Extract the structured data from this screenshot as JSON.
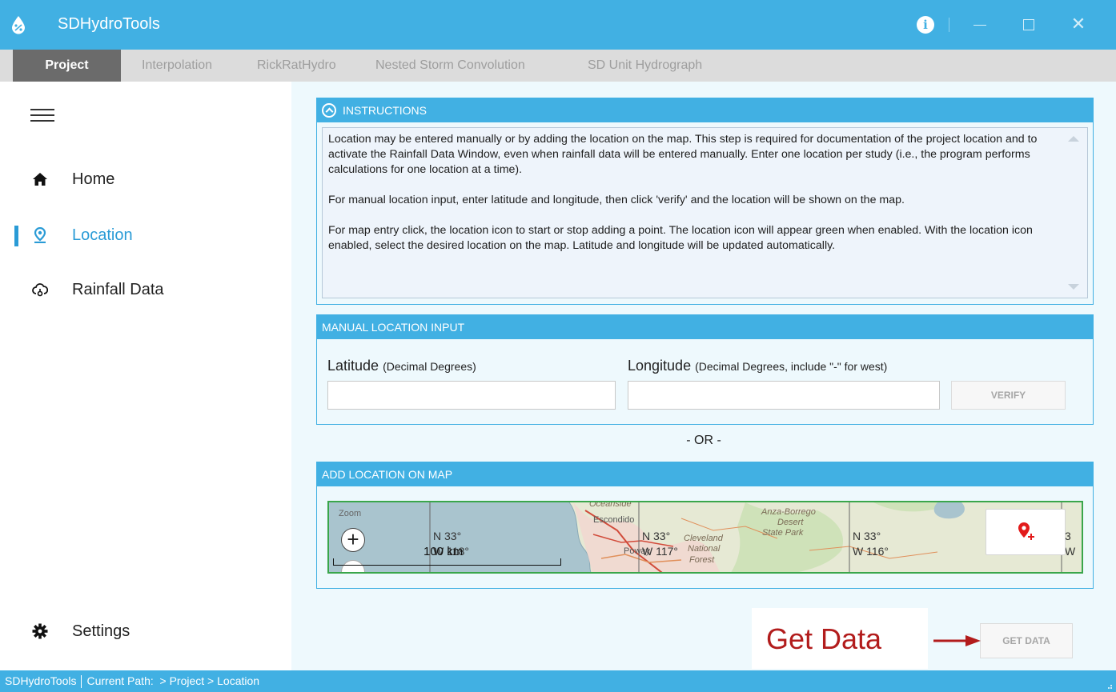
{
  "app": {
    "title": "SDHydroTools",
    "icon": "droplet-icon",
    "accent_color": "#41b0e3"
  },
  "tabs": [
    {
      "label": "Project",
      "active": true
    },
    {
      "label": "Interpolation",
      "active": false
    },
    {
      "label": "RickRatHydro",
      "active": false
    },
    {
      "label": "Nested Storm Convolution",
      "active": false
    },
    {
      "label": "SD Unit Hydrograph",
      "active": false
    }
  ],
  "sidebar": {
    "items": [
      {
        "label": "Home",
        "icon": "home-icon",
        "active": false
      },
      {
        "label": "Location",
        "icon": "location-person-icon",
        "active": true
      },
      {
        "label": "Rainfall Data",
        "icon": "cloud-upload-icon",
        "active": false
      }
    ],
    "settings_label": "Settings",
    "settings_icon": "gear-icon"
  },
  "instructions": {
    "title": "INSTRUCTIONS",
    "paragraphs": [
      "Location may be entered manually or by adding the location on the map. This step is required for documentation of the project location and to activate the Rainfall Data Window, even when rainfall data will be entered manually. Enter one location per study (i.e., the program performs calculations for one location at a time).",
      "For manual location input, enter latitude and longitude, then click 'verify' and the location will be shown on the map.",
      "For map entry click, the location icon to start or stop adding a point. The location icon will appear green when enabled. With the location icon enabled, select the desired location on the map. Latitude and longitude will be updated automatically."
    ]
  },
  "manual": {
    "title": "MANUAL LOCATION INPUT",
    "latitude_label": "Latitude",
    "latitude_hint": "(Decimal Degrees)",
    "latitude_value": "",
    "longitude_label": "Longitude",
    "longitude_hint": "(Decimal Degrees, include \"-\" for west)",
    "longitude_value": "",
    "verify_label": "VERIFY"
  },
  "or_text": "- OR -",
  "map": {
    "title": "ADD LOCATION ON MAP",
    "zoom_label": "Zoom",
    "zoom_in": "+",
    "scale_label": "100 km",
    "grid_labels": [
      {
        "lat": "N 33°",
        "lon": "W 118°"
      },
      {
        "lat": "N 33°",
        "lon": "W 117°"
      },
      {
        "lat": "N 33°",
        "lon": "W 116°"
      },
      {
        "lat": "3",
        "lon": "W"
      }
    ],
    "places": [
      "Escondido",
      "Poway",
      "Cleveland",
      "National",
      "Forest",
      "Anza-Borrego",
      "Desert",
      "State Park",
      "Oceanside"
    ],
    "add_point_icon": "map-pin-add-icon"
  },
  "get_data_label": "GET DATA",
  "annotation": {
    "text": "Get Data"
  },
  "status": {
    "app_name": "SDHydroTools",
    "path_label": "Current Path:",
    "path_value": "> Project > Location"
  }
}
